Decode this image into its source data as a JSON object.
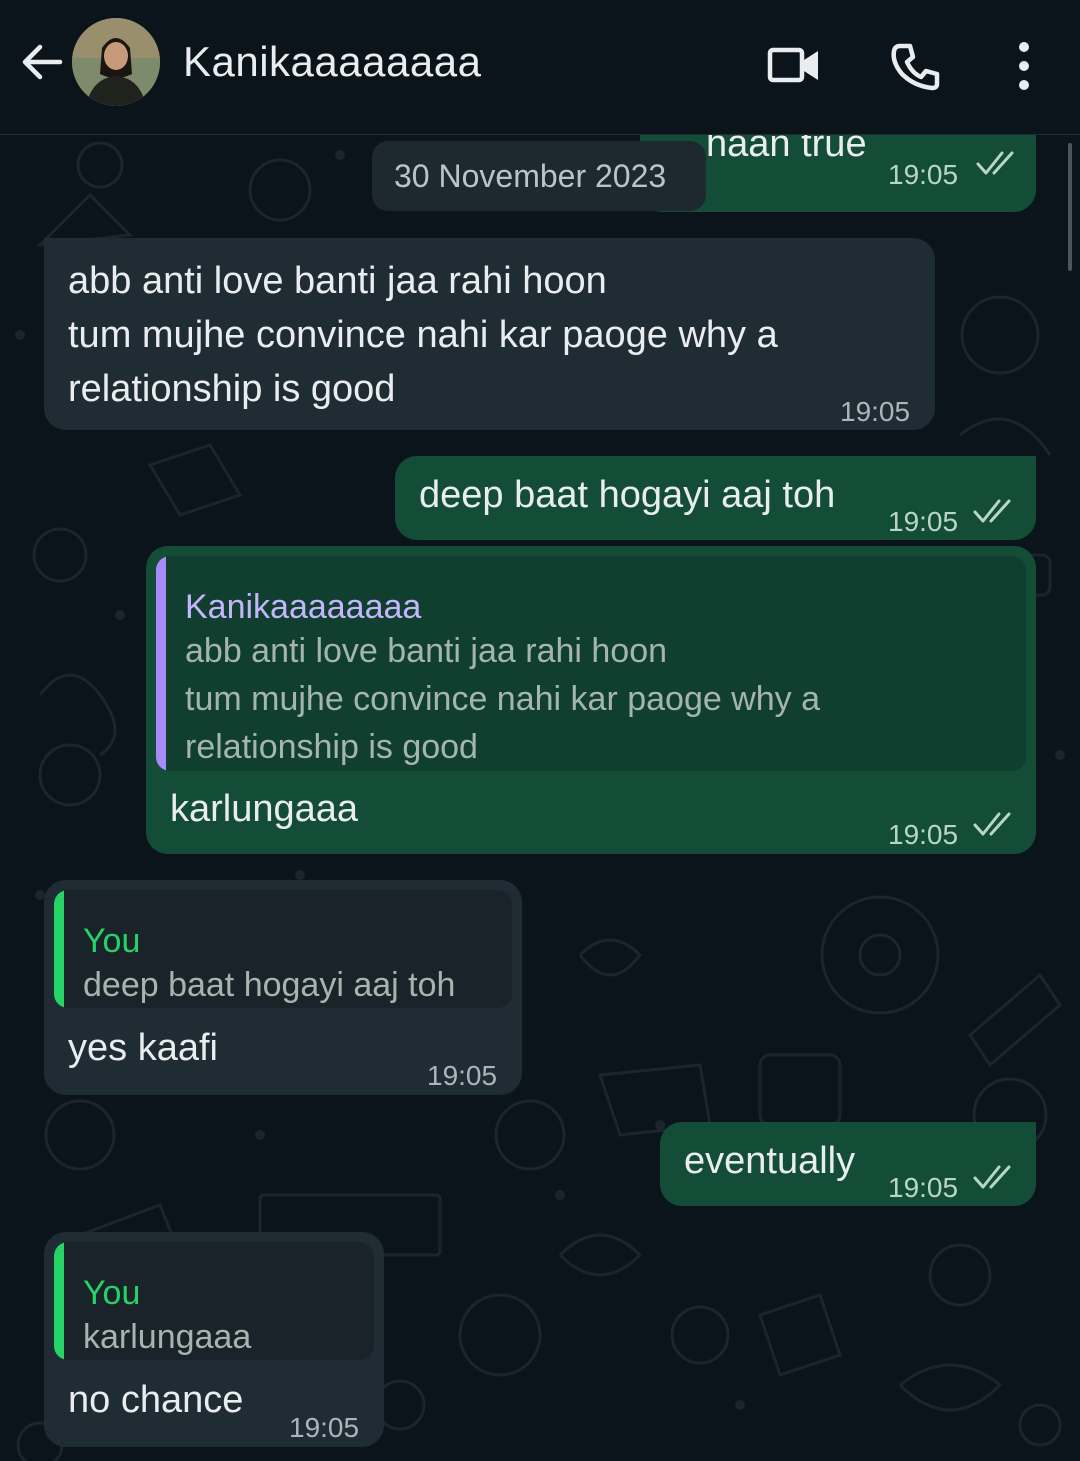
{
  "header": {
    "contact_name": "Kanikaaaaaaaa",
    "icons": [
      "back-arrow-icon",
      "video-call-icon",
      "phone-icon",
      "more-options-icon"
    ]
  },
  "date_chip": "30 November 2023",
  "messages": [
    {
      "dir": "out",
      "text": "haan true",
      "time": "19:05"
    },
    {
      "dir": "in",
      "text": "abb anti love banti jaa rahi hoon\ntum mujhe convince nahi kar paoge why a\nrelationship is good",
      "time": "19:05"
    },
    {
      "dir": "out",
      "text": "deep baat hogayi aaj toh",
      "time": "19:05"
    },
    {
      "dir": "out",
      "quote_name": "Kanikaaaaaaaa",
      "quote_text": "abb anti love banti jaa rahi hoon\ntum mujhe convince nahi kar paoge why a\nrelationship is good",
      "text": "karlungaaa",
      "time": "19:05"
    },
    {
      "dir": "in",
      "quote_name": "You",
      "quote_text": "deep baat hogayi aaj toh",
      "text": "yes kaafi",
      "time": "19:05"
    },
    {
      "dir": "out",
      "text": "eventually",
      "time": "19:05"
    },
    {
      "dir": "in",
      "quote_name": "You",
      "quote_text": "karlungaaa",
      "text": "no chance",
      "time": "19:05"
    }
  ],
  "colors": {
    "background": "#0b141a",
    "incoming_bubble": "#202c33",
    "outgoing_bubble": "#144d37",
    "quote_bar_contact": "#a78bfa",
    "quote_bar_you": "#25d366",
    "quote_name_contact": "#c4b5fd",
    "quote_name_you": "#25d366"
  }
}
